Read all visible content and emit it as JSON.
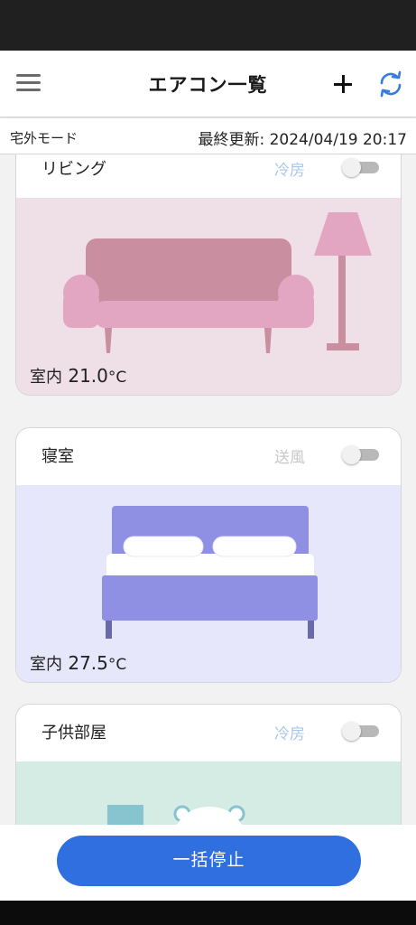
{
  "header": {
    "title": "エアコン一覧",
    "menu_icon": "hamburger-menu-icon",
    "add_icon": "plus-icon",
    "refresh_icon": "refresh-icon",
    "accent_color": "#3a7be0"
  },
  "sub_bar": {
    "mode": "宅外モード",
    "last_updated_label": "最終更新:",
    "last_updated_value": "2024/04/19 20:17"
  },
  "cards": [
    {
      "room": "リビング",
      "mode": "冷房",
      "mode_color": "#a9c9ea",
      "power_on": false,
      "temp_label": "室内",
      "temperature": "21.0",
      "unit": "°C",
      "illustration": "sofa-and-lamp",
      "background": "#efdfe6"
    },
    {
      "room": "寝室",
      "mode": "送風",
      "mode_color": "#c8c8c8",
      "power_on": false,
      "temp_label": "室内",
      "temperature": "27.5",
      "unit": "°C",
      "illustration": "bed",
      "background": "#e6e7fb"
    },
    {
      "room": "子供部屋",
      "mode": "冷房",
      "mode_color": "#a9c9ea",
      "power_on": false,
      "illustration": "kids-room",
      "background": "#d4ece3"
    }
  ],
  "footer": {
    "stop_all_label": "一括停止",
    "button_color": "#2f6fe0"
  }
}
